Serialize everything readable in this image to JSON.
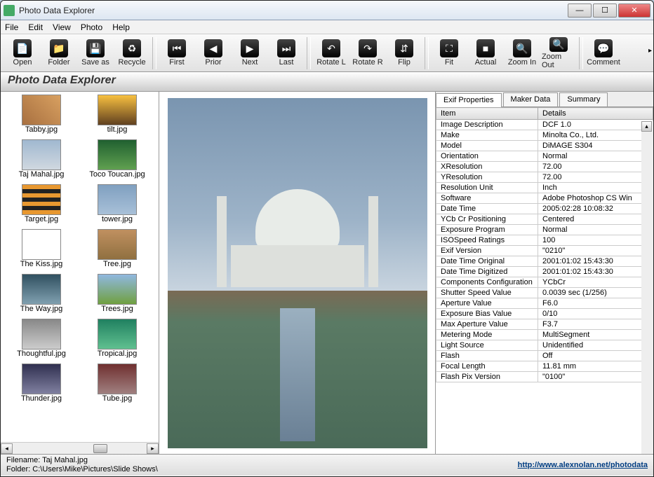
{
  "window": {
    "title": "Photo Data Explorer"
  },
  "menu": {
    "items": [
      "File",
      "Edit",
      "View",
      "Photo",
      "Help"
    ]
  },
  "toolbar": [
    {
      "label": "Open",
      "icon": "📄"
    },
    {
      "label": "Folder",
      "icon": "📁"
    },
    {
      "label": "Save as",
      "icon": "💾"
    },
    {
      "label": "Recycle",
      "icon": "♻"
    },
    {
      "sep": true
    },
    {
      "label": "First",
      "icon": "⏮"
    },
    {
      "label": "Prior",
      "icon": "◀"
    },
    {
      "label": "Next",
      "icon": "▶"
    },
    {
      "label": "Last",
      "icon": "⏭"
    },
    {
      "sep": true
    },
    {
      "label": "Rotate L",
      "icon": "↶"
    },
    {
      "label": "Rotate R",
      "icon": "↷"
    },
    {
      "label": "Flip",
      "icon": "⇵"
    },
    {
      "sep": true
    },
    {
      "label": "Fit",
      "icon": "⛶"
    },
    {
      "label": "Actual",
      "icon": "■"
    },
    {
      "label": "Zoom In",
      "icon": "🔍"
    },
    {
      "label": "Zoom Out",
      "icon": "🔍"
    },
    {
      "sep": true
    },
    {
      "label": "Comment",
      "icon": "💬"
    }
  ],
  "heading": "Photo Data Explorer",
  "thumbs": [
    {
      "label": "Tabby.jpg",
      "bg": "linear-gradient(45deg,#a87040,#d8a060)"
    },
    {
      "label": "tilt.jpg",
      "bg": "linear-gradient(#f8c040,#604020)"
    },
    {
      "label": "Taj Mahal.jpg",
      "bg": "linear-gradient(#a0b8d0,#d0d8e0)"
    },
    {
      "label": "Toco Toucan.jpg",
      "bg": "linear-gradient(#206030,#60a050)"
    },
    {
      "label": "Target.jpg",
      "bg": "repeating-linear-gradient(0deg,#e89830,#e89830 6px,#222 6px,#222 12px)"
    },
    {
      "label": "tower.jpg",
      "bg": "linear-gradient(#80a0c0,#a8c0d8)"
    },
    {
      "label": "The Kiss.jpg",
      "bg": "#fff"
    },
    {
      "label": "Tree.jpg",
      "bg": "linear-gradient(#c09060,#907040)"
    },
    {
      "label": "The Way.jpg",
      "bg": "linear-gradient(#305060,#80a0b0)"
    },
    {
      "label": "Trees.jpg",
      "bg": "linear-gradient(#90b8e0,#70a040)"
    },
    {
      "label": "Thoughtful.jpg",
      "bg": "linear-gradient(#888,#ccc)"
    },
    {
      "label": "Tropical.jpg",
      "bg": "linear-gradient(#208060,#60c090)"
    },
    {
      "label": "Thunder.jpg",
      "bg": "linear-gradient(#303050,#8080a0)"
    },
    {
      "label": "Tube.jpg",
      "bg": "linear-gradient(#703030,#a08080)"
    }
  ],
  "tabs": {
    "items": [
      "Exif Properties",
      "Maker Data",
      "Summary"
    ],
    "active": 0
  },
  "grid": {
    "headers": [
      "Item",
      "Details"
    ],
    "rows": [
      [
        "Image Description",
        "DCF 1.0"
      ],
      [
        "Make",
        "Minolta Co., Ltd."
      ],
      [
        "Model",
        "DiMAGE S304"
      ],
      [
        "Orientation",
        "Normal"
      ],
      [
        "XResolution",
        "72.00"
      ],
      [
        "YResolution",
        "72.00"
      ],
      [
        "Resolution Unit",
        "Inch"
      ],
      [
        "Software",
        "Adobe Photoshop CS Win"
      ],
      [
        "Date Time",
        "2005:02:28 10:08:32"
      ],
      [
        "YCb Cr Positioning",
        "Centered"
      ],
      [
        "Exposure Program",
        "Normal"
      ],
      [
        "ISOSpeed Ratings",
        "100"
      ],
      [
        "Exif Version",
        "\"0210\""
      ],
      [
        "Date Time Original",
        "2001:01:02 15:43:30"
      ],
      [
        "Date Time Digitized",
        "2001:01:02 15:43:30"
      ],
      [
        "Components Configuration",
        "YCbCr"
      ],
      [
        "Shutter Speed Value",
        "0.0039 sec (1/256)"
      ],
      [
        "Aperture Value",
        "F6.0"
      ],
      [
        "Exposure Bias Value",
        "0/10"
      ],
      [
        "Max Aperture Value",
        "F3.7"
      ],
      [
        "Metering Mode",
        "MultiSegment"
      ],
      [
        "Light Source",
        "Unidentified"
      ],
      [
        "Flash",
        "Off"
      ],
      [
        "Focal Length",
        "11.81 mm"
      ],
      [
        "Flash Pix Version",
        "\"0100\""
      ]
    ]
  },
  "status": {
    "filename_label": "Filename: ",
    "filename": "Taj Mahal.jpg",
    "folder_label": "Folder: ",
    "folder": "C:\\Users\\Mike\\Pictures\\Slide Shows\\",
    "link": "http://www.alexnolan.net/photodata"
  }
}
